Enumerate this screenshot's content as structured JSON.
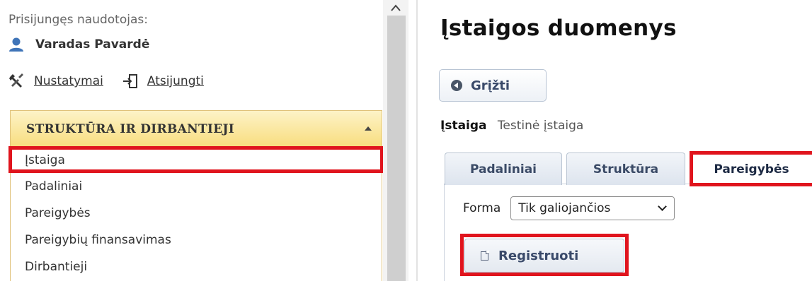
{
  "sidebar": {
    "user_label": "Prisijungęs naudotojas:",
    "user_name": "Varadas Pavardė",
    "links": [
      {
        "label": "Nustatymai",
        "icon": "tools-icon"
      },
      {
        "label": "Atsijungti",
        "icon": "logout-icon"
      }
    ],
    "menu": {
      "title": "STRUKTŪRA IR DIRBANTIEJI",
      "items": [
        {
          "label": "Įstaiga",
          "highlighted": true
        },
        {
          "label": "Padaliniai"
        },
        {
          "label": "Pareigybės"
        },
        {
          "label": "Pareigybių finansavimas"
        },
        {
          "label": "Dirbantieji"
        }
      ]
    }
  },
  "main": {
    "title": "Įstaigos duomenys",
    "back_button": "Grįžti",
    "org": {
      "key": "Įstaiga",
      "value": "Testinė įstaiga"
    },
    "tabs": [
      {
        "label": "Padaliniai"
      },
      {
        "label": "Struktūra"
      },
      {
        "label": "Pareigybės",
        "active": true
      }
    ],
    "forma": {
      "label": "Forma",
      "selected": "Tik galiojančios"
    },
    "register_button": "Registruoti"
  },
  "colors": {
    "highlight": "#e0141d",
    "menu_header": "#f8dd7e",
    "button_text": "#3a4a6a"
  }
}
